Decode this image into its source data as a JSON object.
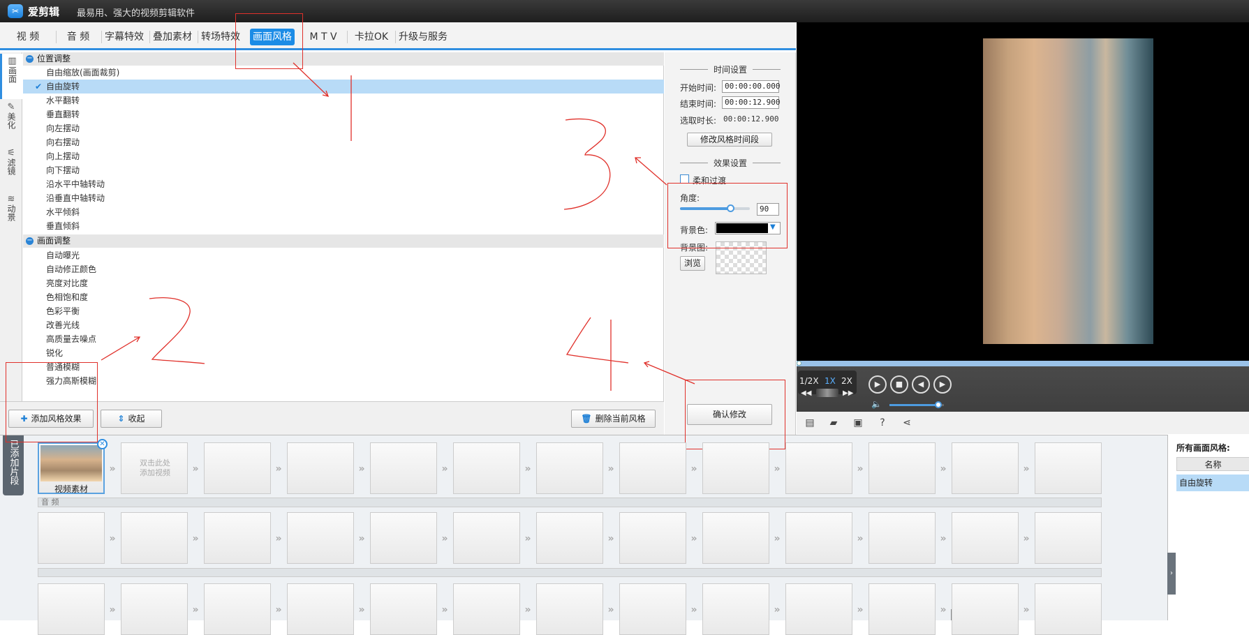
{
  "app": {
    "title": "爱剪辑",
    "subtitle": "最易用、强大的视频剪辑软件"
  },
  "tabs": [
    {
      "label": "视  频"
    },
    {
      "label": "音  频"
    },
    {
      "label": "字幕特效"
    },
    {
      "label": "叠加素材"
    },
    {
      "label": "转场特效"
    },
    {
      "label": "画面风格"
    },
    {
      "label": "M T V"
    },
    {
      "label": "卡拉OK"
    },
    {
      "label": "升级与服务"
    }
  ],
  "side_tabs": [
    {
      "label": "画面"
    },
    {
      "label": "美化"
    },
    {
      "label": "滤镜"
    },
    {
      "label": "动景"
    }
  ],
  "groups": {
    "position": {
      "title": "位置调整",
      "items": [
        "自由缩放(画面裁剪)",
        "自由旋转",
        "水平翻转",
        "垂直翻转",
        "向左摆动",
        "向右摆动",
        "向上摆动",
        "向下摆动",
        "沿水平中轴转动",
        "沿垂直中轴转动",
        "水平倾斜",
        "垂直倾斜"
      ]
    },
    "picture": {
      "title": "画面调整",
      "items": [
        "自动曝光",
        "自动修正颜色",
        "亮度对比度",
        "色相饱和度",
        "色彩平衡",
        "改善光线",
        "高质量去噪点",
        "锐化",
        "普通模糊",
        "强力高斯模糊"
      ]
    }
  },
  "list_buttons": {
    "add": "添加风格效果",
    "collapse": "收起",
    "delete": "删除当前风格"
  },
  "time_settings": {
    "title": "时间设置",
    "start_label": "开始时间:",
    "start_value": "00:00:00.000",
    "end_label": "结束时间:",
    "end_value": "00:00:12.900",
    "duration_label": "选取时长:",
    "duration_value": "00:00:12.900",
    "modify_button": "修改风格时间段"
  },
  "effect_settings": {
    "title": "效果设置",
    "soft_label": "柔和过渡",
    "angle_label": "角度:",
    "angle_value": "90",
    "angle_fraction": 0.72,
    "bgcolor_label": "背景色:",
    "bgcolor_value": "#000000",
    "bgimage_label": "背景图:",
    "browse_button": "浏览",
    "confirm_button": "确认修改"
  },
  "player": {
    "speed_half": "1/2X",
    "speed_one": "1X",
    "speed_two": "2X",
    "volume_fraction": 0.9
  },
  "timeline": {
    "added_tab": "已添加片段",
    "clip1_caption": "视频素材",
    "placeholder_line1": "双击此处",
    "placeholder_line2": "添加视频",
    "audio_label": "音  频"
  },
  "right_panel": {
    "title": "所有画面风格:",
    "column": "名称",
    "item": "自由旋转"
  },
  "annotations": [
    "1",
    "2",
    "3",
    "4"
  ]
}
